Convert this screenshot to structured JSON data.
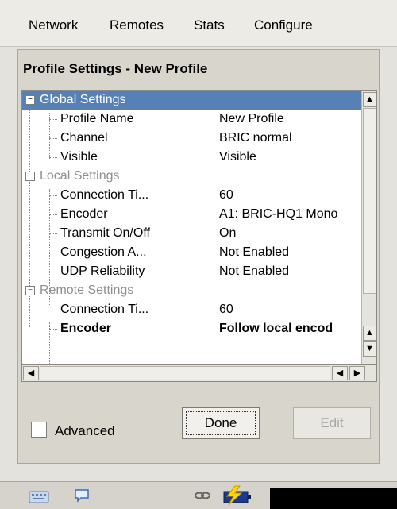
{
  "menu": {
    "items": [
      "Network",
      "Remotes",
      "Stats",
      "Configure"
    ]
  },
  "panel": {
    "title": "Profile Settings - New Profile"
  },
  "tree": {
    "rows": [
      {
        "label": "Global Settings",
        "value": ""
      },
      {
        "label": "Profile Name",
        "value": "New Profile"
      },
      {
        "label": "Channel",
        "value": "BRIC normal"
      },
      {
        "label": "Visible",
        "value": "Visible"
      },
      {
        "label": "Local Settings",
        "value": ""
      },
      {
        "label": "Connection Ti...",
        "value": "60"
      },
      {
        "label": "Encoder",
        "value": "A1: BRIC-HQ1 Mono"
      },
      {
        "label": "Transmit On/Off",
        "value": "On"
      },
      {
        "label": "Congestion A...",
        "value": "Not Enabled"
      },
      {
        "label": "UDP Reliability",
        "value": "Not Enabled"
      },
      {
        "label": "Remote Settings",
        "value": ""
      },
      {
        "label": "Connection Ti...",
        "value": "60"
      },
      {
        "label": "Encoder",
        "value": "Follow local encod"
      }
    ]
  },
  "footer": {
    "advanced_label": "Advanced",
    "done_label": "Done",
    "edit_label": "Edit"
  },
  "status": {
    "icons": [
      "keyboard-icon",
      "chat-icon",
      "link-icon",
      "battery-charging-icon"
    ]
  }
}
